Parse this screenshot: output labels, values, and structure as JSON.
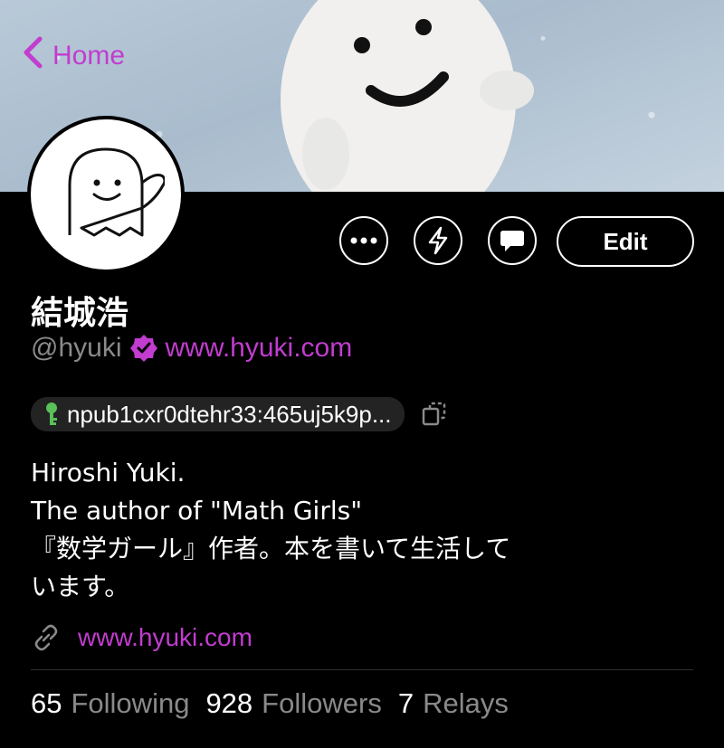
{
  "nav": {
    "back_label": "Home"
  },
  "profile": {
    "display_name": "結城浩",
    "handle": "@hyuki",
    "nip05": "www.hyuki.com",
    "npub": "npub1cxr0dtehr33:465uj5k9p...",
    "bio": [
      "Hiroshi Yuki.",
      "The author of \"Math Girls\"",
      "『数学ガール』作者。本を書いて生活して",
      "います。"
    ],
    "website": "www.hyuki.com"
  },
  "actions": {
    "edit_label": "Edit"
  },
  "stats": [
    {
      "count": "65",
      "label": "Following"
    },
    {
      "count": "928",
      "label": "Followers"
    },
    {
      "count": "7",
      "label": "Relays"
    }
  ],
  "colors": {
    "accent": "#c13ccf",
    "muted": "#8a8a8a",
    "background": "#000000"
  },
  "icons": [
    "chevron-left-icon",
    "more-icon",
    "zap-icon",
    "message-icon",
    "verified-icon",
    "key-icon",
    "copy-icon",
    "link-icon"
  ]
}
